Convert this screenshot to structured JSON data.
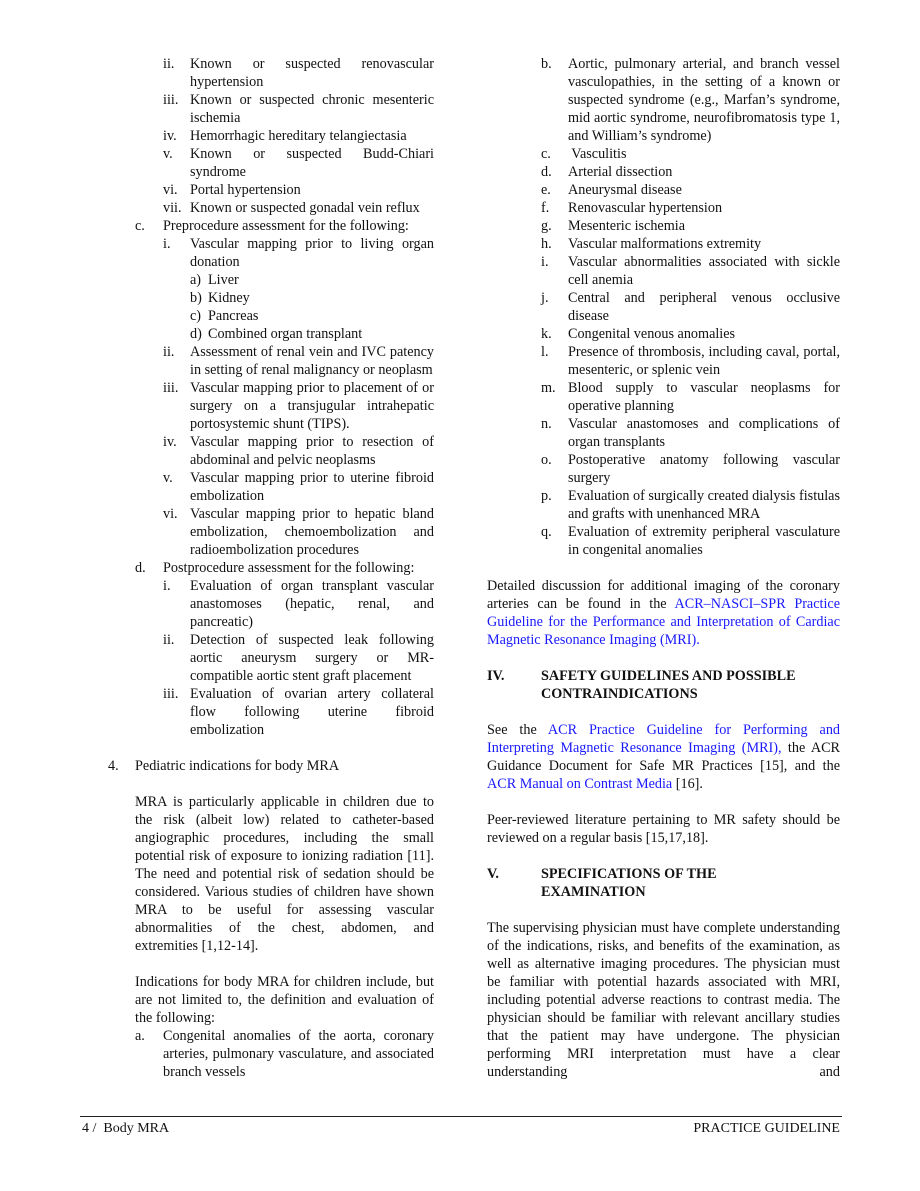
{
  "left_column": {
    "b_items": [
      {
        "marker": "ii.",
        "text": "Known or suspected renovascular hypertension"
      },
      {
        "marker": "iii.",
        "text": "Known or suspected chronic mesenteric ischemia"
      },
      {
        "marker": "iv.",
        "text": "Hemorrhagic hereditary telangiectasia"
      },
      {
        "marker": "v.",
        "text": "Known or suspected Budd-Chiari syndrome"
      },
      {
        "marker": "vi.",
        "text": "Portal hypertension"
      },
      {
        "marker": "vii.",
        "text": "Known or suspected gonadal vein reflux"
      }
    ],
    "c": {
      "marker": "c.",
      "text": "Preprocedure assessment for the following:",
      "i": {
        "marker": "i.",
        "text": "Vascular mapping prior to living organ donation"
      },
      "i_sub": [
        {
          "marker": "a)",
          "text": "Liver"
        },
        {
          "marker": "b)",
          "text": "Kidney"
        },
        {
          "marker": "c)",
          "text": "Pancreas"
        },
        {
          "marker": "d)",
          "text": "Combined organ transplant"
        }
      ],
      "items": [
        {
          "marker": "ii.",
          "text": "Assessment of renal vein and IVC patency in setting of renal malignancy or neoplasm"
        },
        {
          "marker": "iii.",
          "text": "Vascular mapping prior to placement of or surgery on a transjugular intrahepatic portosystemic shunt (TIPS)."
        },
        {
          "marker": "iv.",
          "text": "Vascular mapping prior to resection of abdominal and pelvic neoplasms"
        },
        {
          "marker": "v.",
          "text": "Vascular mapping prior to uterine fibroid embolization"
        },
        {
          "marker": "vi.",
          "text": "Vascular mapping prior to hepatic bland embolization, chemoembolization and radioembolization procedures"
        }
      ]
    },
    "d": {
      "marker": "d.",
      "text": "Postprocedure assessment for the following:",
      "items": [
        {
          "marker": "i.",
          "text": "Evaluation of organ transplant vascular anastomoses (hepatic, renal, and pancreatic)"
        },
        {
          "marker": "ii.",
          "text": "Detection of suspected leak following aortic aneurysm surgery or MR-compatible aortic stent graft placement"
        },
        {
          "marker": "iii.",
          "text": "Evaluation of ovarian artery collateral flow following uterine fibroid embolization"
        }
      ]
    },
    "section4": {
      "marker": "4.",
      "title": "Pediatric indications for body MRA",
      "para1": "MRA is particularly applicable in children due to the risk (albeit low) related to catheter-based angiographic procedures, including the small potential risk of exposure to ionizing radiation [11]. The need and potential risk of sedation should be considered. Various studies of children have shown MRA to be useful for assessing vascular abnormalities of the chest, abdomen, and extremities [1,12-14].",
      "para2": "Indications for body MRA for children include, but are not limited to, the definition and evaluation of the following:",
      "a": {
        "marker": "a.",
        "text": "Congenital anomalies of the aorta, coronary arteries, pulmonary vasculature, and associated branch vessels"
      }
    }
  },
  "right_column": {
    "items": [
      {
        "marker": "b.",
        "text": "Aortic, pulmonary arterial, and branch vessel vasculopathies, in the setting of a known or suspected syndrome (e.g., Marfan’s syndrome, mid aortic syndrome, neurofibromatosis type 1, and William’s syndrome)"
      },
      {
        "marker": "c.",
        "text": " Vasculitis"
      },
      {
        "marker": "d.",
        "text": "Arterial dissection"
      },
      {
        "marker": "e.",
        "text": "Aneurysmal disease"
      },
      {
        "marker": "f.",
        "text": "Renovascular hypertension"
      },
      {
        "marker": "g.",
        "text": "Mesenteric ischemia"
      },
      {
        "marker": "h.",
        "text": "Vascular malformations extremity"
      },
      {
        "marker": "i.",
        "text": "Vascular abnormalities associated with sickle cell anemia"
      },
      {
        "marker": "j.",
        "text": "Central and peripheral venous occlusive disease"
      },
      {
        "marker": "k.",
        "text": "Congenital venous anomalies"
      },
      {
        "marker": "l.",
        "text": "Presence of thrombosis, including caval, portal, mesenteric, or splenic vein"
      },
      {
        "marker": "m.",
        "text": "Blood supply to vascular neoplasms for operative planning"
      },
      {
        "marker": "n.",
        "text": "Vascular anastomoses and complications of organ transplants"
      },
      {
        "marker": "o.",
        "text": "Postoperative anatomy following vascular surgery"
      },
      {
        "marker": "p.",
        "text": "Evaluation of surgically created dialysis fistulas and grafts with unenhanced MRA"
      },
      {
        "marker": "q.",
        "text": "Evaluation of extremity peripheral vasculature in congenital anomalies"
      }
    ],
    "coronary_para": {
      "before": "Detailed discussion for additional imaging of the coronary arteries can be found in the ",
      "link": "ACR–NASCI–SPR Practice Guideline for the Performance and Interpretation of Cardiac Magnetic Resonance Imaging (MRI)."
    },
    "section_iv": {
      "marker": "IV.",
      "title_line1": "SAFETY GUIDELINES AND POSSIBLE",
      "title_line2": "CONTRAINDICATIONS",
      "para1": {
        "t1": "See the ",
        "link1": "ACR Practice Guideline for Performing and Interpreting Magnetic Resonance Imaging (MRI),",
        "t2": " the ACR Guidance Document for Safe MR Practices [15], and the ",
        "link2": "ACR Manual on Contrast Media",
        "t3": " [16]."
      },
      "para2": "Peer-reviewed literature pertaining to MR safety should be reviewed on a regular basis [15,17,18]."
    },
    "section_v": {
      "marker": "V.",
      "title_line1": "SPECIFICATIONS OF THE",
      "title_line2": "EXAMINATION",
      "para": "The supervising physician must have complete understanding of the indications, risks, and benefits of the examination, as well as alternative imaging procedures. The physician must be familiar with potential hazards associated with MRI, including potential adverse reactions to contrast media. The physician should be familiar with relevant ancillary studies that the patient may have undergone. The physician performing MRI interpretation must have a clear understanding and"
    }
  },
  "footer": {
    "left": "4 /  Body MRA",
    "right": "PRACTICE GUIDELINE"
  },
  "colors": {
    "text": "#111111",
    "link": "#1a1aff"
  }
}
